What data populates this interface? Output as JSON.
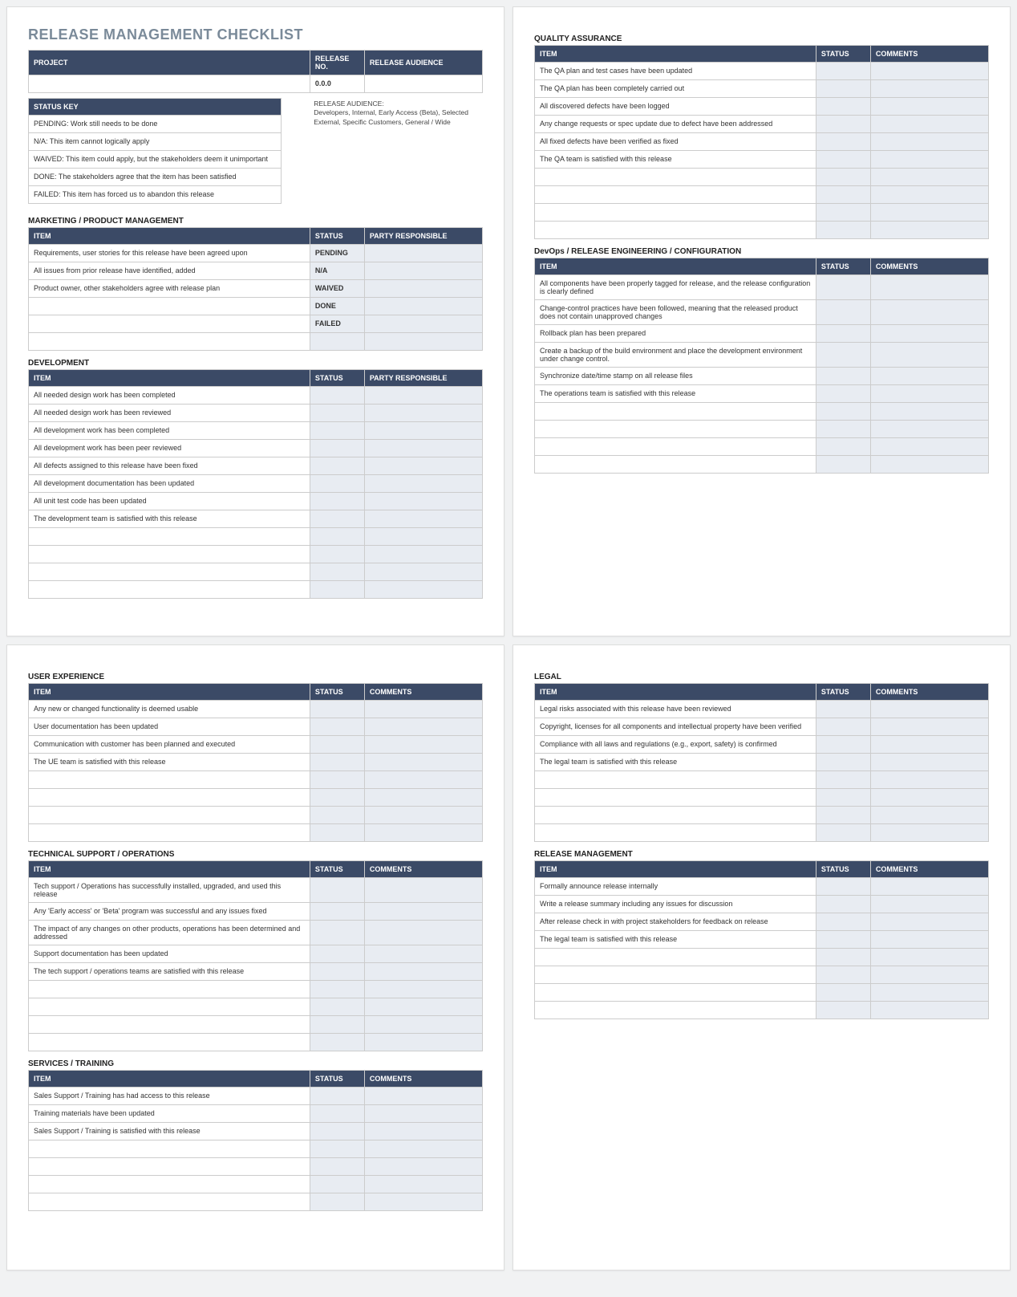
{
  "title": "RELEASE MANAGEMENT CHECKLIST",
  "topHeaders": {
    "project": "PROJECT",
    "releaseNo": "RELEASE NO.",
    "releaseAudience": "RELEASE AUDIENCE"
  },
  "topValues": {
    "project": "",
    "releaseNo": "0.0.0",
    "releaseAudience": ""
  },
  "statusKey": {
    "header": "STATUS KEY",
    "rows": [
      "PENDING:  Work still needs to be done",
      "N/A:  This item cannot logically apply",
      "WAIVED:  This item could apply, but the stakeholders deem it unimportant",
      "DONE:  The stakeholders agree that the item has been satisfied",
      "FAILED:  This item has forced us to abandon this release"
    ]
  },
  "audienceNote": {
    "label": "RELEASE AUDIENCE:",
    "text": "Developers, Internal, Early Access (Beta), Selected External, Specific Customers, General / Wide"
  },
  "colHeaders": {
    "item": "ITEM",
    "status": "STATUS",
    "party": "PARTY RESPONSIBLE",
    "comments": "COMMENTS"
  },
  "sections": {
    "marketing": {
      "title": "MARKETING / PRODUCT MANAGEMENT",
      "thirdCol": "party",
      "rows": [
        {
          "item": "Requirements, user stories for this release have been agreed upon",
          "status": "PENDING"
        },
        {
          "item": "All issues from prior release have identified, added",
          "status": "N/A"
        },
        {
          "item": "Product owner, other stakeholders agree with release plan",
          "status": "WAIVED"
        },
        {
          "item": "",
          "status": "DONE"
        },
        {
          "item": "",
          "status": "FAILED"
        },
        {
          "item": "",
          "status": ""
        }
      ]
    },
    "development": {
      "title": "DEVELOPMENT",
      "thirdCol": "party",
      "rows": [
        {
          "item": "All needed design work has been completed"
        },
        {
          "item": "All needed design work has been reviewed"
        },
        {
          "item": "All development work has been completed"
        },
        {
          "item": "All development work has been peer reviewed"
        },
        {
          "item": "All defects assigned to this release have been fixed"
        },
        {
          "item": "All development documentation has been updated"
        },
        {
          "item": "All unit test code has been updated"
        },
        {
          "item": "The development team is satisfied with this release"
        },
        {
          "item": ""
        },
        {
          "item": ""
        },
        {
          "item": ""
        },
        {
          "item": ""
        }
      ]
    },
    "qa": {
      "title": "QUALITY ASSURANCE",
      "thirdCol": "comments",
      "rows": [
        {
          "item": "The QA plan and test cases have been updated"
        },
        {
          "item": "The QA plan has been completely carried out"
        },
        {
          "item": "All discovered defects have been logged"
        },
        {
          "item": "Any change requests or spec update due to defect have been addressed"
        },
        {
          "item": "All fixed defects have been verified as fixed"
        },
        {
          "item": "The QA team is satisfied with this release"
        },
        {
          "item": ""
        },
        {
          "item": ""
        },
        {
          "item": ""
        },
        {
          "item": ""
        }
      ]
    },
    "devops": {
      "title": "DevOps / RELEASE ENGINEERING / CONFIGURATION",
      "thirdCol": "comments",
      "rows": [
        {
          "item": "All components have been properly tagged for release, and the release configuration is clearly defined"
        },
        {
          "item": "Change-control practices have been followed, meaning that the released product does not contain unapproved changes"
        },
        {
          "item": "Rollback plan has been prepared"
        },
        {
          "item": "Create a backup of the build environment and place the development environment under change control."
        },
        {
          "item": "Synchronize date/time stamp on all release files"
        },
        {
          "item": "The operations team is satisfied with this release"
        },
        {
          "item": ""
        },
        {
          "item": ""
        },
        {
          "item": ""
        },
        {
          "item": ""
        }
      ]
    },
    "ux": {
      "title": "USER EXPERIENCE",
      "thirdCol": "comments",
      "rows": [
        {
          "item": "Any new or changed functionality is deemed usable"
        },
        {
          "item": "User documentation has been updated"
        },
        {
          "item": "Communication with customer has been planned and executed"
        },
        {
          "item": "The UE team is satisfied with this release"
        },
        {
          "item": ""
        },
        {
          "item": ""
        },
        {
          "item": ""
        },
        {
          "item": ""
        }
      ]
    },
    "techsupport": {
      "title": "TECHNICAL SUPPORT / OPERATIONS",
      "thirdCol": "comments",
      "rows": [
        {
          "item": "Tech support / Operations has successfully installed, upgraded, and used this release"
        },
        {
          "item": "Any 'Early access' or 'Beta' program was successful and any issues fixed"
        },
        {
          "item": "The impact of any changes on other products, operations has been determined and addressed"
        },
        {
          "item": "Support documentation has been updated"
        },
        {
          "item": "The tech support / operations teams are satisfied with this release"
        },
        {
          "item": ""
        },
        {
          "item": ""
        },
        {
          "item": ""
        },
        {
          "item": ""
        }
      ]
    },
    "services": {
      "title": "SERVICES / TRAINING",
      "thirdCol": "comments",
      "rows": [
        {
          "item": "Sales Support / Training has had access to this release"
        },
        {
          "item": "Training materials have been updated"
        },
        {
          "item": "Sales Support / Training is satisfied with this release"
        },
        {
          "item": ""
        },
        {
          "item": ""
        },
        {
          "item": ""
        },
        {
          "item": ""
        }
      ]
    },
    "legal": {
      "title": "LEGAL",
      "thirdCol": "comments",
      "rows": [
        {
          "item": "Legal risks associated with this release have been reviewed"
        },
        {
          "item": "Copyright, licenses for all components and intellectual property have been verified"
        },
        {
          "item": "Compliance with all laws and regulations (e.g., export, safety) is confirmed"
        },
        {
          "item": "The legal team is satisfied with this release"
        },
        {
          "item": ""
        },
        {
          "item": ""
        },
        {
          "item": ""
        },
        {
          "item": ""
        }
      ]
    },
    "releasemgmt": {
      "title": "RELEASE MANAGEMENT",
      "thirdCol": "comments",
      "rows": [
        {
          "item": "Formally announce release internally"
        },
        {
          "item": "Write a release summary including any issues for discussion"
        },
        {
          "item": "After release check in with project stakeholders for feedback on release"
        },
        {
          "item": "The legal team is satisfied with this release"
        },
        {
          "item": ""
        },
        {
          "item": ""
        },
        {
          "item": ""
        },
        {
          "item": ""
        }
      ]
    }
  }
}
